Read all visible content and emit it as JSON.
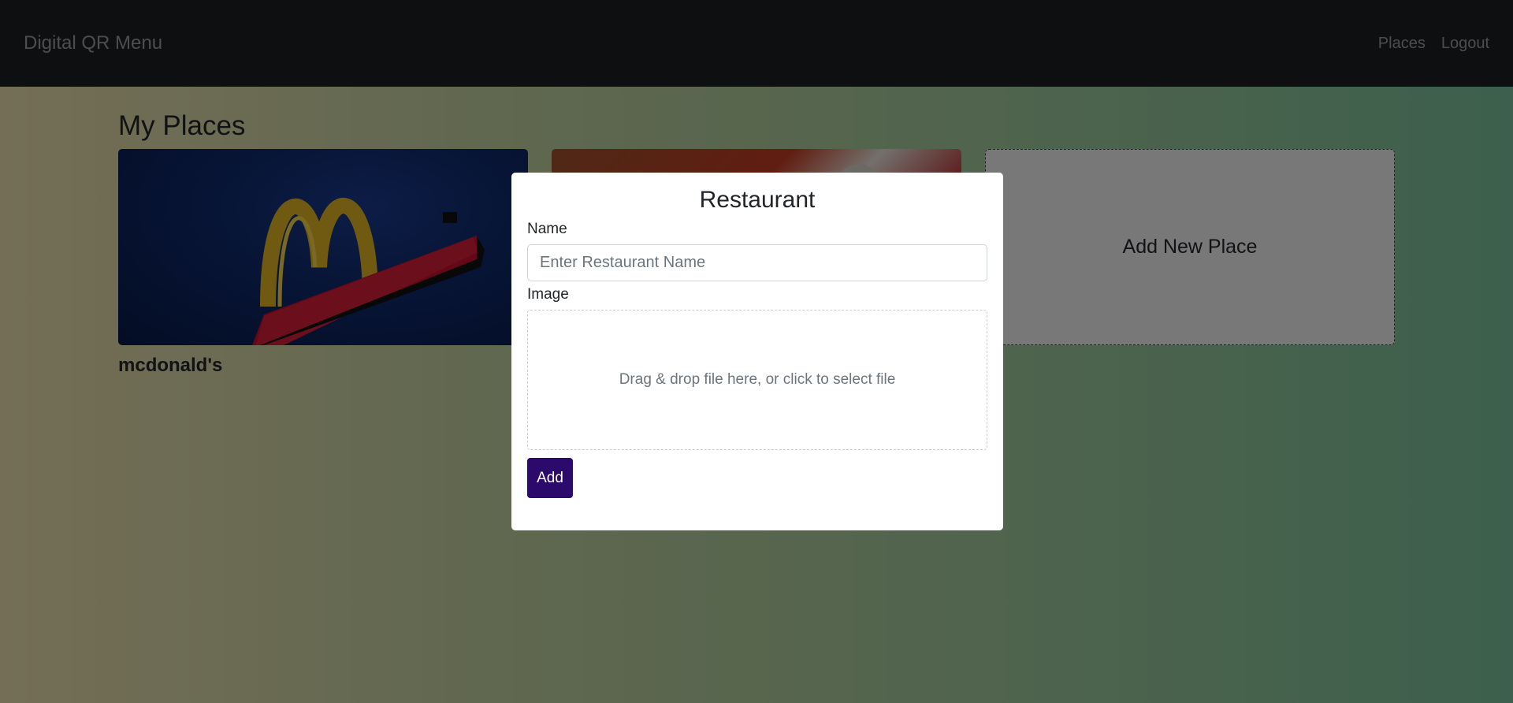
{
  "navbar": {
    "brand": "Digital QR Menu",
    "links": [
      {
        "label": "Places"
      },
      {
        "label": "Logout"
      }
    ]
  },
  "main": {
    "title": "My Places",
    "places": [
      {
        "name": "mcdonald's",
        "image": "mcdonalds-sign-image"
      },
      {
        "name": "",
        "image": "fried-food-image"
      }
    ],
    "add_place_label": "Add New Place"
  },
  "modal": {
    "title": "Restaurant",
    "name_label": "Name",
    "name_placeholder": "Enter Restaurant Name",
    "name_value": "",
    "image_label": "Image",
    "dropzone_text": "Drag & drop file here, or click to select file",
    "submit_label": "Add"
  },
  "colors": {
    "navbar_bg": "#1c1f23",
    "submit_button": "#2b0a6b"
  }
}
